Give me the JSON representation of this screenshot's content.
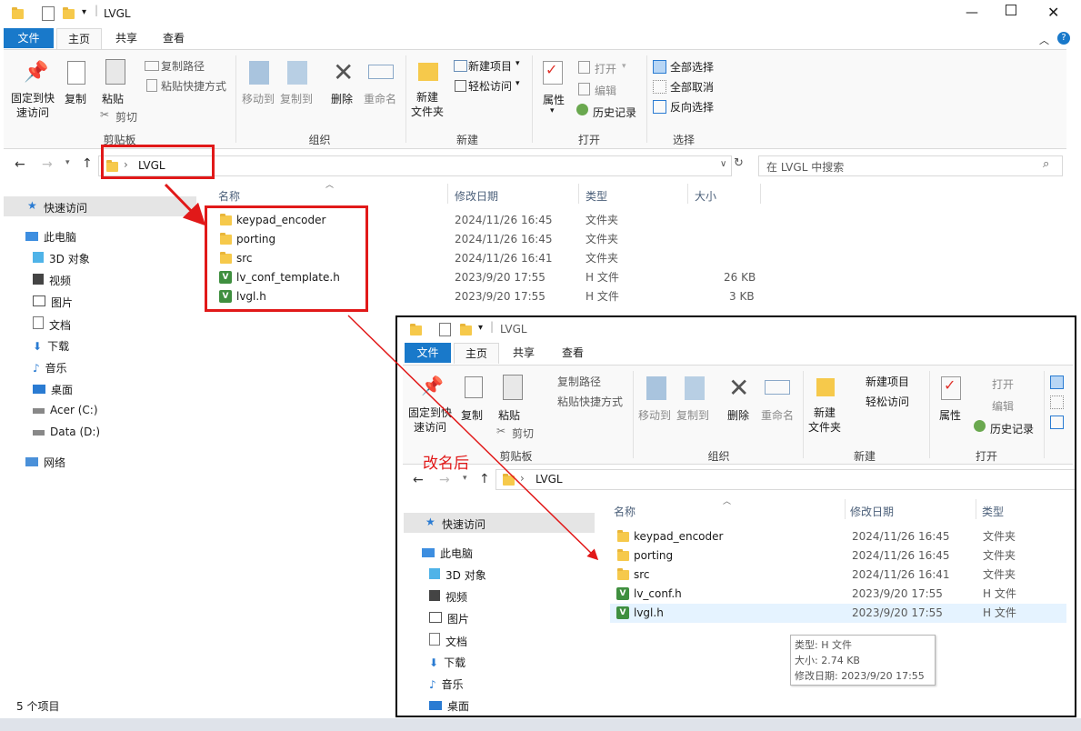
{
  "back_window": {
    "title": "LVGL",
    "tabs": [
      "文件",
      "主页",
      "共享",
      "查看"
    ],
    "ribbon": {
      "pin_label": "固定到快\n速访问",
      "copy_label": "复制",
      "paste_label": "粘贴",
      "copy_path": "复制路径",
      "paste_shortcut": "粘贴快捷方式",
      "cut": "剪切",
      "group_clipboard": "剪贴板",
      "move_to": "移动到",
      "copy_to": "复制到",
      "delete": "删除",
      "rename": "重命名",
      "group_organize": "组织",
      "new_folder": "新建\n文件夹",
      "new_item": "新建项目",
      "easy_access": "轻松访问",
      "group_new": "新建",
      "properties": "属性",
      "open": "打开",
      "edit": "编辑",
      "history": "历史记录",
      "group_open": "打开",
      "select_all": "全部选择",
      "select_none": "全部取消",
      "invert_selection": "反向选择",
      "group_select": "选择"
    },
    "address": "LVGL",
    "search_placeholder": "在 LVGL 中搜索",
    "columns": {
      "name": "名称",
      "date": "修改日期",
      "type": "类型",
      "size": "大小"
    },
    "files": [
      {
        "name": "keypad_encoder",
        "date": "2024/11/26 16:45",
        "type": "文件夹",
        "size": "",
        "icon": "folder-icon"
      },
      {
        "name": "porting",
        "date": "2024/11/26 16:45",
        "type": "文件夹",
        "size": "",
        "icon": "folder-icon"
      },
      {
        "name": "src",
        "date": "2024/11/26 16:41",
        "type": "文件夹",
        "size": "",
        "icon": "folder-icon"
      },
      {
        "name": "lv_conf_template.h",
        "date": "2023/9/20 17:55",
        "type": "H 文件",
        "size": "26 KB",
        "icon": "h-file-icon"
      },
      {
        "name": "lvgl.h",
        "date": "2023/9/20 17:55",
        "type": "H 文件",
        "size": "3 KB",
        "icon": "h-file-icon"
      }
    ],
    "sidebar": [
      {
        "label": "快速访问",
        "icon": "star-icon"
      },
      {
        "label": "此电脑",
        "icon": "computer-icon"
      },
      {
        "label": "3D 对象",
        "icon": "cube-icon"
      },
      {
        "label": "视频",
        "icon": "video-icon"
      },
      {
        "label": "图片",
        "icon": "picture-icon"
      },
      {
        "label": "文档",
        "icon": "document-icon"
      },
      {
        "label": "下载",
        "icon": "download-icon"
      },
      {
        "label": "音乐",
        "icon": "music-icon"
      },
      {
        "label": "桌面",
        "icon": "desktop-icon"
      },
      {
        "label": "Acer (C:)",
        "icon": "drive-icon"
      },
      {
        "label": "Data (D:)",
        "icon": "drive-icon"
      },
      {
        "label": "网络",
        "icon": "network-icon"
      }
    ],
    "status": "5 个项目"
  },
  "front_window": {
    "title": "LVGL",
    "tabs": [
      "文件",
      "主页",
      "共享",
      "查看"
    ],
    "annotation": "改名后",
    "address": "LVGL",
    "columns": {
      "name": "名称",
      "date": "修改日期",
      "type": "类型"
    },
    "files": [
      {
        "name": "keypad_encoder",
        "date": "2024/11/26 16:45",
        "type": "文件夹",
        "icon": "folder-icon"
      },
      {
        "name": "porting",
        "date": "2024/11/26 16:45",
        "type": "文件夹",
        "icon": "folder-icon"
      },
      {
        "name": "src",
        "date": "2024/11/26 16:41",
        "type": "文件夹",
        "icon": "folder-icon"
      },
      {
        "name": "lv_conf.h",
        "date": "2023/9/20 17:55",
        "type": "H 文件",
        "icon": "h-file-icon"
      },
      {
        "name": "lvgl.h",
        "date": "2023/9/20 17:55",
        "type": "H 文件",
        "icon": "h-file-icon"
      }
    ],
    "sidebar": [
      {
        "label": "快速访问"
      },
      {
        "label": "此电脑"
      },
      {
        "label": "3D 对象"
      },
      {
        "label": "视频"
      },
      {
        "label": "图片"
      },
      {
        "label": "文档"
      },
      {
        "label": "下载"
      },
      {
        "label": "音乐"
      },
      {
        "label": "桌面"
      }
    ],
    "tooltip": {
      "type": "类型: H 文件",
      "size": "大小: 2.74 KB",
      "modified": "修改日期: 2023/9/20 17:55"
    }
  },
  "colors": {
    "accent": "#1979ca",
    "annotation_red": "#e11919",
    "folder": "#f6c94b",
    "selection": "#cce8ff"
  }
}
